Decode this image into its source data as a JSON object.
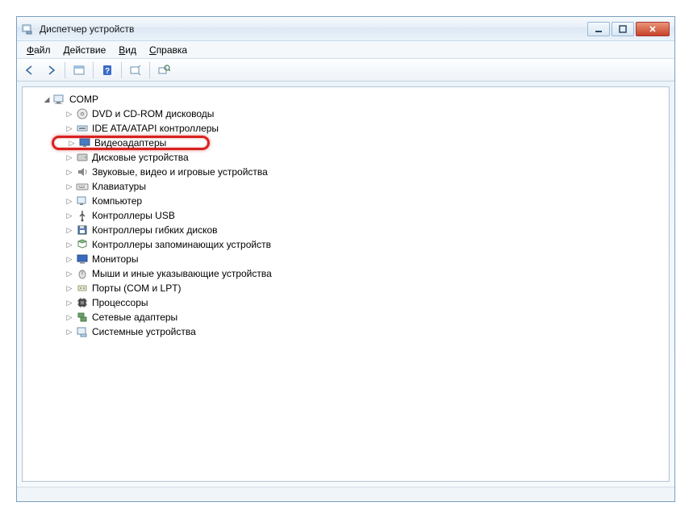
{
  "titlebar": {
    "title": "Диспетчер устройств"
  },
  "menubar": {
    "items": [
      {
        "u": "Ф",
        "rest": "айл"
      },
      {
        "u": "Д",
        "rest": "ействие"
      },
      {
        "u": "В",
        "rest": "ид"
      },
      {
        "u": "С",
        "rest": "правка"
      }
    ]
  },
  "toolbar": {
    "back": "back",
    "forward": "forward"
  },
  "tree": {
    "root": "COMP",
    "children": [
      {
        "icon": "disc",
        "label": "DVD и CD-ROM дисководы",
        "highlighted": false
      },
      {
        "icon": "ide",
        "label": "IDE ATA/ATAPI контроллеры",
        "highlighted": false
      },
      {
        "icon": "display",
        "label": "Видеоадаптеры",
        "highlighted": true
      },
      {
        "icon": "drive",
        "label": "Дисковые устройства",
        "highlighted": false
      },
      {
        "icon": "sound",
        "label": "Звуковые, видео и игровые устройства",
        "highlighted": false
      },
      {
        "icon": "keyboard",
        "label": "Клавиатуры",
        "highlighted": false
      },
      {
        "icon": "computer",
        "label": "Компьютер",
        "highlighted": false
      },
      {
        "icon": "usb",
        "label": "Контроллеры USB",
        "highlighted": false
      },
      {
        "icon": "floppy",
        "label": "Контроллеры гибких дисков",
        "highlighted": false
      },
      {
        "icon": "storage",
        "label": "Контроллеры запоминающих устройств",
        "highlighted": false
      },
      {
        "icon": "monitor",
        "label": "Мониторы",
        "highlighted": false
      },
      {
        "icon": "mouse",
        "label": "Мыши и иные указывающие устройства",
        "highlighted": false
      },
      {
        "icon": "port",
        "label": "Порты (COM и LPT)",
        "highlighted": false
      },
      {
        "icon": "cpu",
        "label": "Процессоры",
        "highlighted": false
      },
      {
        "icon": "network",
        "label": "Сетевые адаптеры",
        "highlighted": false
      },
      {
        "icon": "system",
        "label": "Системные устройства",
        "highlighted": false
      }
    ]
  },
  "icons": {
    "disc": "<svg width='16' height='16'><circle cx='8' cy='8' r='6' fill='#e8e8e8' stroke='#888'/><circle cx='8' cy='8' r='1.5' fill='#fff' stroke='#888'/></svg>",
    "ide": "<svg width='16' height='16'><rect x='2' y='5' width='12' height='6' fill='#d9e6f2' stroke='#6a8faf'/><rect x='4' y='7' width='8' height='2' fill='#888'/></svg>",
    "display": "<svg width='16' height='16'><rect x='2' y='3' width='12' height='8' fill='#4a7ac0' stroke='#355a8f'/><rect x='6' y='11' width='4' height='2' fill='#888'/></svg>",
    "drive": "<svg width='16' height='16'><rect x='2' y='4' width='12' height='8' rx='1' fill='#d0d0d0' stroke='#888'/><circle cx='12' cy='8' r='1' fill='#6a6'/></svg>",
    "sound": "<svg width='16' height='16'><polygon points='3,6 6,6 10,3 10,13 6,10 3,10' fill='#888'/><path d='M12 5 q2 3 0 6' fill='none' stroke='#888'/></svg>",
    "keyboard": "<svg width='16' height='16'><rect x='1' y='5' width='14' height='7' rx='1' fill='#e8e8e8' stroke='#888'/><rect x='3' y='7' width='2' height='1' fill='#888'/><rect x='6' y='7' width='2' height='1' fill='#888'/><rect x='9' y='7' width='2' height='1' fill='#888'/><rect x='4' y='9' width='7' height='1' fill='#888'/></svg>",
    "computer": "<svg width='16' height='16'><rect x='2' y='3' width='10' height='8' fill='#e6f0f8' stroke='#6a8faf'/><rect x='5' y='11' width='4' height='2' fill='#888'/></svg>",
    "usb": "<svg width='16' height='16'><path d='M8 2 v12 M8 6 l-3 3 M8 6 l3 3' stroke='#555' stroke-width='1.4' fill='none'/><circle cx='8' cy='14' r='1.5' fill='#555'/></svg>",
    "floppy": "<svg width='16' height='16'><rect x='3' y='3' width='10' height='10' fill='#5a7ac0' stroke='#355'/><rect x='5' y='3' width='5' height='3' fill='#ddd'/><rect x='5' y='8' width='6' height='4' fill='#fff'/></svg>",
    "storage": "<svg width='16' height='16'><path d='M3 4 l5 -2 l5 2 l-5 2 z' fill='#8ac08a' stroke='#5a8a5a'/><path d='M3 4 v6 l5 2 l5 -2 v-6' fill='none' stroke='#5a8a5a'/></svg>",
    "monitor": "<svg width='16' height='16'><rect x='2' y='3' width='12' height='8' fill='#3a6ac0' stroke='#254a88'/><rect x='5' y='12' width='6' height='1.5' fill='#888'/></svg>",
    "mouse": "<svg width='16' height='16'><ellipse cx='8' cy='9' rx='4' ry='5' fill='#e0e0e0' stroke='#888'/><line x1='8' y1='4' x2='8' y2='9' stroke='#888'/></svg>",
    "port": "<svg width='16' height='16'><rect x='3' y='5' width='10' height='6' fill='#e8e8d0' stroke='#a0a070'/><circle cx='6' cy='8' r='1' fill='#888'/><circle cx='10' cy='8' r='1' fill='#888'/></svg>",
    "cpu": "<svg width='16' height='16'><rect x='4' y='4' width='8' height='8' fill='#555' stroke='#222'/><rect x='6' y='6' width='4' height='4' fill='#888'/><path d='M4 6 h-2 M4 10 h-2 M12 6 h2 M12 10 h2 M6 4 v-2 M10 4 v-2 M6 12 v2 M10 12 v2' stroke='#555'/></svg>",
    "network": "<svg width='16' height='16'><rect x='3' y='3' width='7' height='5' fill='#6aa06a' stroke='#4a7a4a'/><rect x='6' y='8' width='7' height='5' fill='#6aa06a' stroke='#4a7a4a'/></svg>",
    "system": "<svg width='16' height='16'><rect x='2' y='3' width='10' height='8' fill='#e6f0f8' stroke='#6a8faf'/><rect x='6' y='11' width='7' height='3' fill='#c0d0e0' stroke='#6a8faf'/></svg>"
  }
}
